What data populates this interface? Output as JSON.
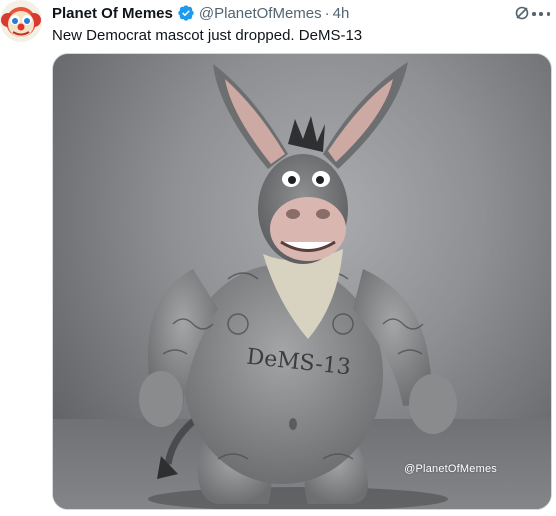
{
  "tweet": {
    "display_name": "Planet Of Memes",
    "handle": "@PlanetOfMemes",
    "separator": "·",
    "time": "4h",
    "text": "New Democrat mascot just dropped. DeMS-13"
  },
  "media": {
    "belly_text": "DeMS-13",
    "watermark": "@PlanetOfMemes"
  },
  "icons": {
    "verified": "verified-badge-icon",
    "grok": "grok-icon",
    "more": "more-options-icon"
  },
  "colors": {
    "verified_blue": "#1d9bf0",
    "text_primary": "#0f1419",
    "text_secondary": "#536471"
  }
}
